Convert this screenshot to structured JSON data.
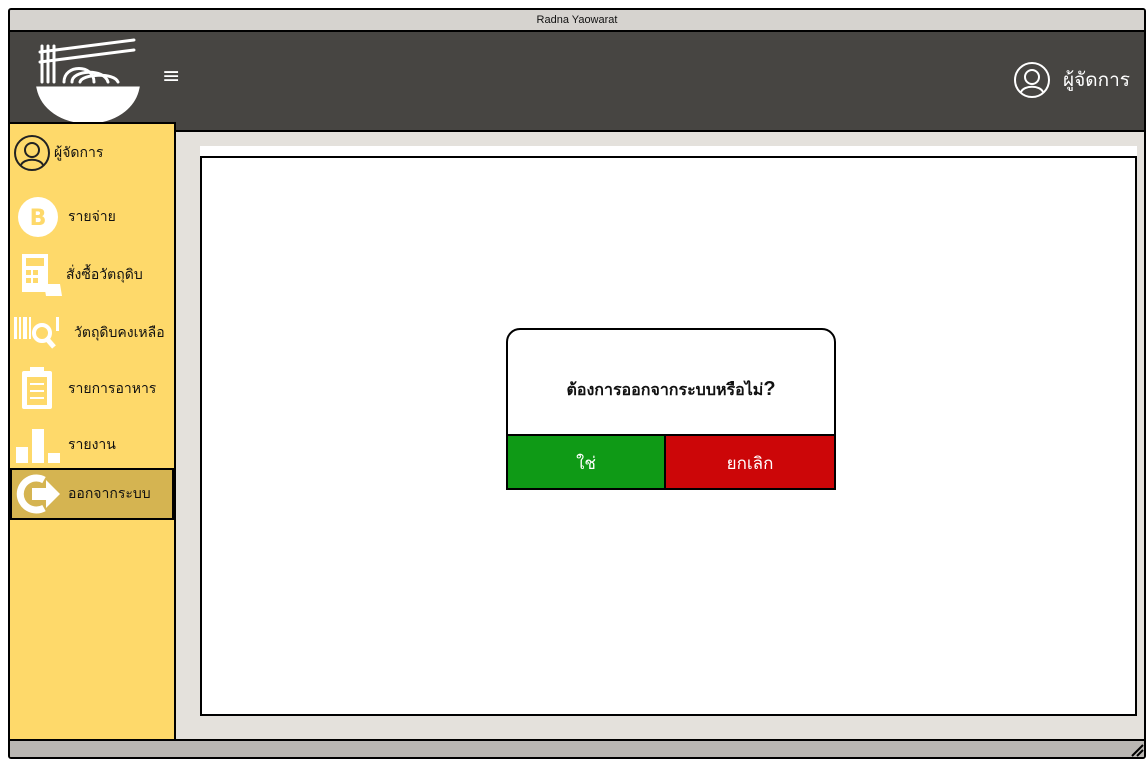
{
  "window": {
    "title": "Radna Yaowarat"
  },
  "header": {
    "menu_icon": "hamburger-icon",
    "user_label": "ผู้จัดการ"
  },
  "sidebar": {
    "items": [
      {
        "label": "ผู้จัดการ",
        "icon": "user-icon"
      },
      {
        "label": "รายจ่าย",
        "icon": "bitcoin-icon"
      },
      {
        "label": "สั่งซื้อวัตถุดิบ",
        "icon": "calculator-icon"
      },
      {
        "label": "วัตถุดิบคงเหลือ",
        "icon": "barcode-search-icon"
      },
      {
        "label": "รายการอาหาร",
        "icon": "clipboard-icon"
      },
      {
        "label": "รายงาน",
        "icon": "bar-chart-icon"
      },
      {
        "label": "ออกจากระบบ",
        "icon": "logout-icon",
        "active": true
      }
    ]
  },
  "dialog": {
    "message": "ต้องการออกจากระบบหรือไม่",
    "message_mark": "?",
    "confirm_label": "ใช่",
    "cancel_label": "ยกเลิก"
  },
  "colors": {
    "header": "#474542",
    "sidebar": "#fed96a",
    "sidebar_active": "#d5b451",
    "confirm": "#0f9a16",
    "cancel": "#cc0608"
  }
}
